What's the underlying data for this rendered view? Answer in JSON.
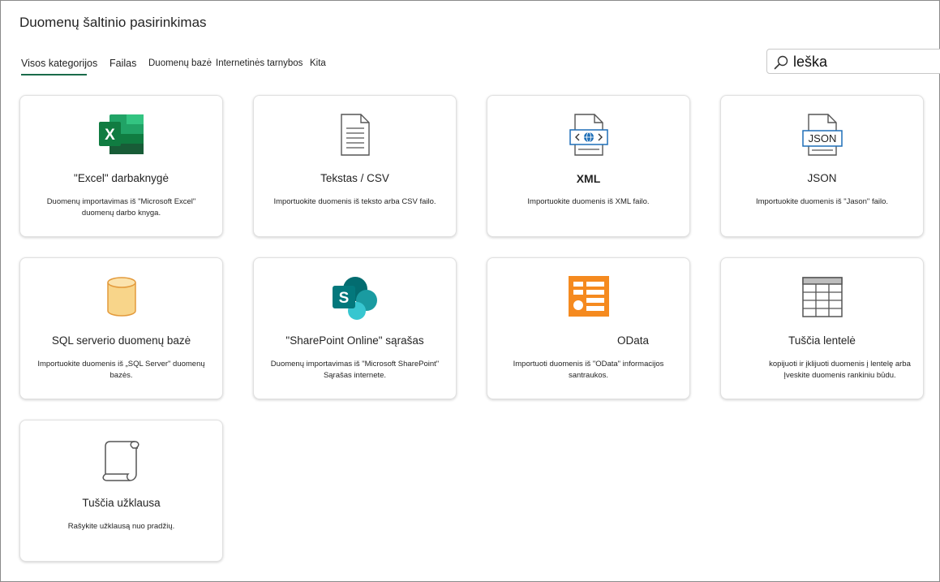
{
  "dialog": {
    "title": "Duomenų šaltinio pasirinkimas"
  },
  "tabs": [
    {
      "label": "Visos kategorijos",
      "selected": true
    },
    {
      "label": "Failas"
    },
    {
      "label": "Duomenų bazė"
    },
    {
      "label": "Internetinės tarnybos"
    },
    {
      "label": "Kita"
    }
  ],
  "search": {
    "value": "leška",
    "icon": "search-icon"
  },
  "cards": [
    {
      "title": "\"Excel\" darbaknygė",
      "description": "Duomenų importavimas iš \"Microsoft Excel\" duomenų darbo knyga.",
      "icon": "excel-icon"
    },
    {
      "title": "Tekstas / CSV",
      "description": "Importuokite duomenis iš teksto arba CSV failo.",
      "icon": "text-file-icon"
    },
    {
      "title": "XML",
      "description": "Importuokite duomenis iš XML failo.",
      "icon": "xml-file-icon"
    },
    {
      "title": "JSON",
      "description": "Importuokite duomenis iš \"Jason\" failo.",
      "icon": "json-file-icon",
      "icon_label": "JSON"
    },
    {
      "title": "SQL serverio duomenų bazė",
      "description": "Importuokite duomenis iš „SQL Server\" duomenų bazės.",
      "icon": "database-icon"
    },
    {
      "title": "\"SharePoint Online\" sąrašas",
      "description": "Duomenų importavimas iš \"Microsoft SharePoint\" Sąrašas internete.",
      "icon": "sharepoint-icon",
      "icon_letter": "S"
    },
    {
      "title": "OData",
      "description": "Importuoti duomenis iš \"OData\" informacijos santraukos.",
      "icon": "odata-icon"
    },
    {
      "title": "Tuščia lentelė",
      "description": "kopijuoti ir įklijuoti duomenis į lentelę arba Įveskite duomenis rankiniu būdu.",
      "icon": "blank-table-icon"
    },
    {
      "title": "Tuščia užklausa",
      "description": "Rašykite užklausą nuo pradžių.",
      "icon": "blank-query-icon"
    }
  ],
  "colors": {
    "accent": "#1a6b4a",
    "excel_green": "#107c41",
    "sharepoint_teal": "#038387",
    "odata_orange": "#f58a1f",
    "database_fill": "#f8d58a",
    "database_stroke": "#e39a3b"
  }
}
